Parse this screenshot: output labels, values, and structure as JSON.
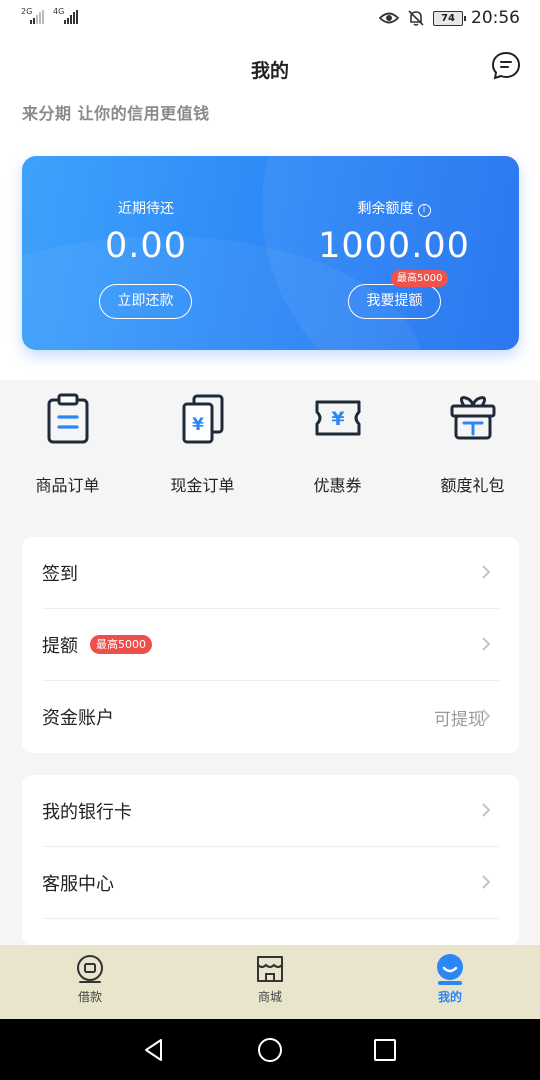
{
  "status_bar": {
    "signal1": "2G",
    "signal2": "4G",
    "battery": "74",
    "time": "20:56",
    "icons": [
      "eye-icon",
      "bell-off-icon",
      "battery-icon"
    ]
  },
  "header": {
    "title": "我的",
    "slogan": "来分期  让你的信用更值钱"
  },
  "card": {
    "left_label": "近期待还",
    "left_amount": "0.00",
    "left_button": "立即还款",
    "right_label": "剩余额度",
    "right_amount": "1000.00",
    "right_button": "我要提额",
    "badge": "最高5000"
  },
  "quick_actions": [
    {
      "label": "商品订单",
      "icon": "clipboard-icon"
    },
    {
      "label": "现金订单",
      "icon": "cash-document-icon"
    },
    {
      "label": "优惠券",
      "icon": "coupon-icon"
    },
    {
      "label": "额度礼包",
      "icon": "gift-icon"
    }
  ],
  "list1": [
    {
      "label": "签到"
    },
    {
      "label": "提额",
      "badge": "最高5000"
    },
    {
      "label": "资金账户",
      "value": "可提现"
    }
  ],
  "list2": [
    {
      "label": "我的银行卡"
    },
    {
      "label": "客服中心"
    }
  ],
  "tabbar": [
    {
      "label": "借款",
      "icon": "loan-icon",
      "active": false
    },
    {
      "label": "商城",
      "icon": "store-icon",
      "active": false
    },
    {
      "label": "我的",
      "icon": "profile-icon",
      "active": true
    }
  ],
  "colors": {
    "accent": "#2b86f6",
    "badge_red": "#ef4f4a",
    "tabbar_bg": "#e9e5cc"
  }
}
